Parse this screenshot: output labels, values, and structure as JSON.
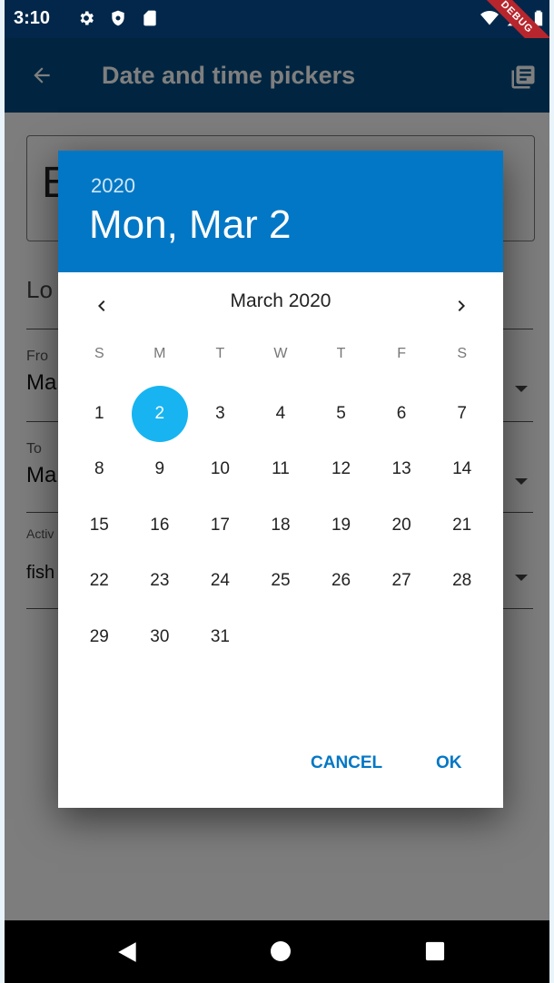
{
  "status_bar": {
    "time": "3:10",
    "icons": [
      "settings-icon",
      "shield-icon",
      "sd-card-icon",
      "wifi-icon",
      "signal-icon",
      "battery-icon"
    ]
  },
  "debug_banner": "DEBUG",
  "app_bar": {
    "title": "Date and time pickers",
    "back_icon": "arrow-back-icon",
    "action_icon": "library-books-icon"
  },
  "background_form": {
    "text_field_value": "E",
    "heading": "Lo",
    "from_label": "Fro",
    "from_value": "Ma",
    "to_label": "To",
    "to_value": "Ma",
    "activity_label": "Activ",
    "activity_value": "fish"
  },
  "date_picker": {
    "header": {
      "year": "2020",
      "date": "Mon, Mar 2"
    },
    "month_label": "March 2020",
    "weekdays": [
      "S",
      "M",
      "T",
      "W",
      "T",
      "F",
      "S"
    ],
    "first_day_offset": 0,
    "days": [
      "1",
      "2",
      "3",
      "4",
      "5",
      "6",
      "7",
      "8",
      "9",
      "10",
      "11",
      "12",
      "13",
      "14",
      "15",
      "16",
      "17",
      "18",
      "19",
      "20",
      "21",
      "22",
      "23",
      "24",
      "25",
      "26",
      "27",
      "28",
      "29",
      "30",
      "31"
    ],
    "selected_day": "2",
    "cancel_label": "CANCEL",
    "ok_label": "OK"
  },
  "colors": {
    "status_bar": "#02274a",
    "app_bar": "#024a80",
    "header": "#0277c5",
    "selected_day": "#17b4f1",
    "button_text": "#0277c5",
    "debug_banner": "#b8262d"
  },
  "nav_bar": {
    "icons": [
      "nav-back-icon",
      "nav-home-icon",
      "nav-recents-icon"
    ]
  }
}
